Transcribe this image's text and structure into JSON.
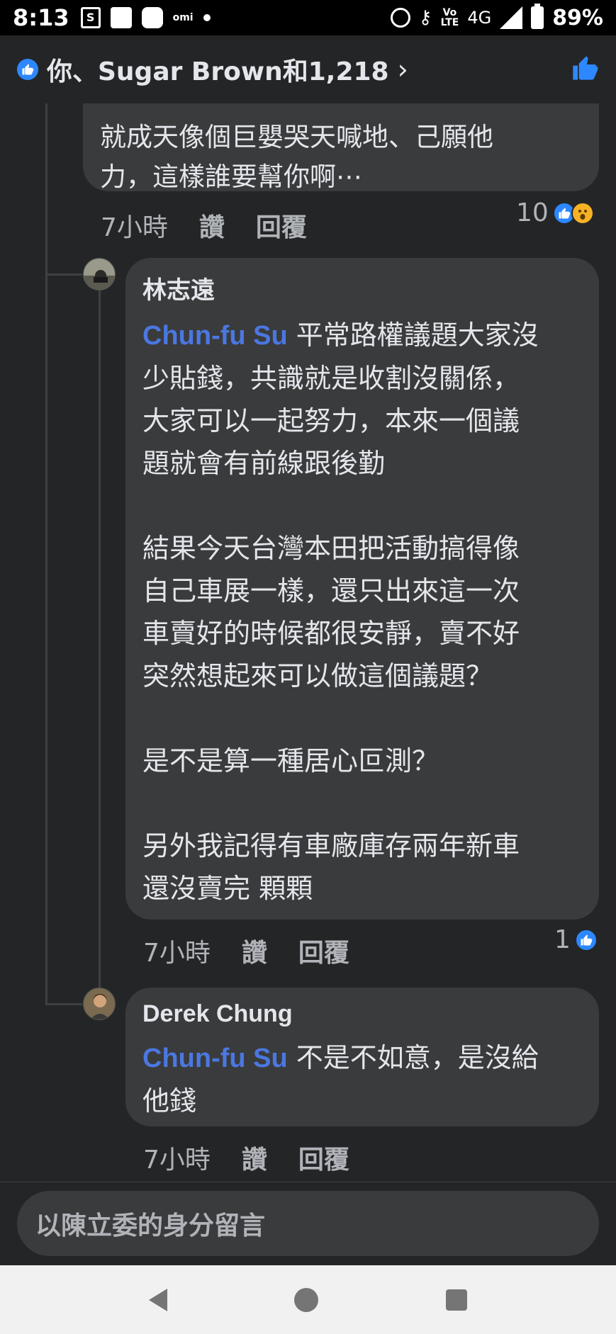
{
  "status_bar": {
    "time": "8:13",
    "omi_label": "omi",
    "network": "4G",
    "volte": "Vo LTE",
    "battery": "89%"
  },
  "header": {
    "reactors_text": "你、Sugar Brown和1,218",
    "chevron": "›"
  },
  "comments": [
    {
      "text": "就成天像個巨嬰哭天喊地、己願他\n力，這樣誰要幫你啊⋯",
      "time": "7小時",
      "like_label": "讚",
      "reply_label": "回覆",
      "reaction_count": "10"
    },
    {
      "author": "林志遠",
      "mention": "Chun-fu Su",
      "text_after_mention": " 平常路權議題大家沒\n少貼錢，共識就是收割沒關係，\n大家可以一起努力，本來一個議\n題就會有前線跟後勤\n\n結果今天台灣本田把活動搞得像\n自己車展一樣，還只出來這一次\n車賣好的時候都很安靜，賣不好\n突然想起來可以做這個議題？\n\n是不是算一種居心叵測？\n\n另外我記得有車廠庫存兩年新車\n還沒賣完 顆顆",
      "time": "7小時",
      "like_label": "讚",
      "reply_label": "回覆",
      "reaction_count": "1"
    },
    {
      "author": "Derek Chung",
      "mention": "Chun-fu Su",
      "text_after_mention": " 不是不如意，是沒給\n他錢",
      "time": "7小時",
      "like_label": "讚",
      "reply_label": "回覆"
    }
  ],
  "composer": {
    "placeholder": "以陳立委的身分留言"
  },
  "colors": {
    "background": "#242526",
    "bubble": "#3a3b3c",
    "mention": "#4b77e0",
    "like_blue": "#2d88ff",
    "meta_text": "#b0b3b8"
  }
}
